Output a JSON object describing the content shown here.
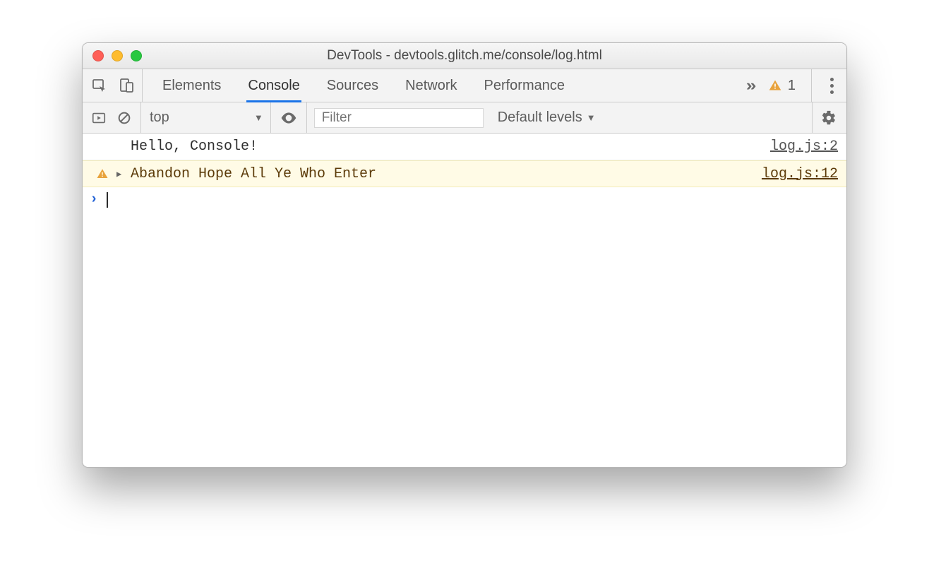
{
  "window": {
    "title": "DevTools - devtools.glitch.me/console/log.html"
  },
  "tabs": {
    "elements": "Elements",
    "console": "Console",
    "sources": "Sources",
    "network": "Network",
    "performance": "Performance",
    "warning_count": "1"
  },
  "filter": {
    "context": "top",
    "filter_placeholder": "Filter",
    "levels_label": "Default levels"
  },
  "console": {
    "rows": [
      {
        "message": "Hello, Console!",
        "source": "log.js:2"
      },
      {
        "message": "Abandon Hope All Ye Who Enter",
        "source": "log.js:12"
      }
    ]
  }
}
